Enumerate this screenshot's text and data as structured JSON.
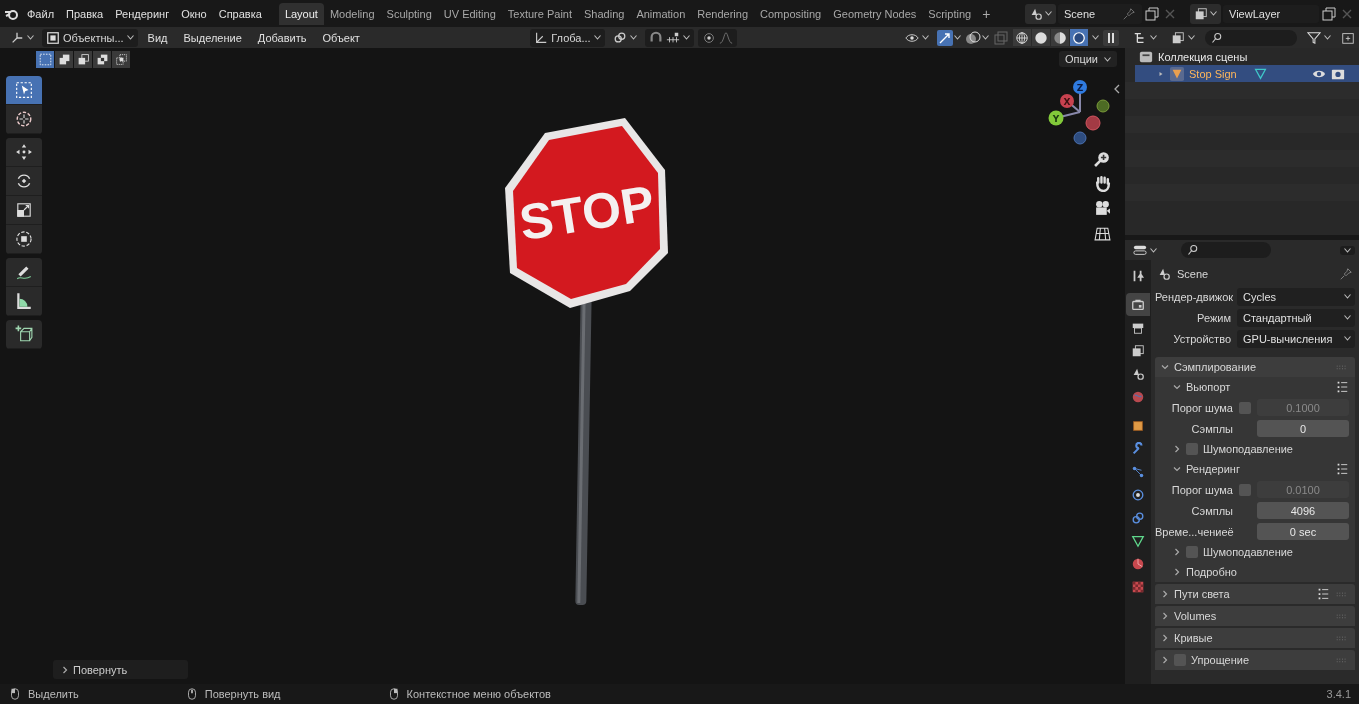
{
  "menu": [
    "Файл",
    "Правка",
    "Рендеринг",
    "Окно",
    "Справка"
  ],
  "workspaces": [
    {
      "label": "Layout",
      "selected": true
    },
    {
      "label": "Modeling",
      "selected": false
    },
    {
      "label": "Sculpting",
      "selected": false
    },
    {
      "label": "UV Editing",
      "selected": false
    },
    {
      "label": "Texture Paint",
      "selected": false
    },
    {
      "label": "Shading",
      "selected": false
    },
    {
      "label": "Animation",
      "selected": false
    },
    {
      "label": "Rendering",
      "selected": false
    },
    {
      "label": "Compositing",
      "selected": false
    },
    {
      "label": "Geometry Nodes",
      "selected": false
    },
    {
      "label": "Scripting",
      "selected": false
    }
  ],
  "add_workspace": "+",
  "scene": "Scene",
  "view_layer": "ViewLayer",
  "viewport": {
    "mode": "Объектны...",
    "menus": [
      "Вид",
      "Выделение",
      "Добавить",
      "Объект"
    ],
    "orientation": "Глоба...",
    "shading": [
      {
        "kind": "wireframe",
        "selected": false
      },
      {
        "kind": "solid",
        "selected": false
      },
      {
        "kind": "material",
        "selected": false
      },
      {
        "kind": "rendered",
        "selected": true
      }
    ],
    "select_modes": [
      {
        "kind": "set",
        "selected": true
      },
      {
        "kind": "extend",
        "selected": false
      },
      {
        "kind": "subtract",
        "selected": false
      },
      {
        "kind": "difference",
        "selected": false
      },
      {
        "kind": "intersect",
        "selected": false
      }
    ],
    "options": "Опции",
    "tools": [
      [
        {
          "kind": "select-box",
          "selected": true
        },
        {
          "kind": "cursor",
          "selected": false
        }
      ],
      [
        {
          "kind": "move",
          "selected": false
        },
        {
          "kind": "rotate",
          "selected": false
        },
        {
          "kind": "scale",
          "selected": false
        },
        {
          "kind": "transform",
          "selected": false
        }
      ],
      [
        {
          "kind": "annotate",
          "selected": false
        },
        {
          "kind": "measure",
          "selected": false
        }
      ],
      [
        {
          "kind": "add-cube",
          "selected": false
        }
      ]
    ],
    "axis_labels": [
      "X",
      "Y",
      "Z"
    ],
    "sign_text": "STOP",
    "last_operator": "Повернуть"
  },
  "outliner": {
    "collection": "Коллекция сцены",
    "objects": [
      {
        "name": "Stop Sign",
        "selected": true
      }
    ]
  },
  "properties": {
    "tabs": [
      {
        "kind": "tool",
        "selected": false
      },
      {
        "kind": "render",
        "selected": true
      },
      {
        "kind": "output",
        "selected": false
      },
      {
        "kind": "view-layer",
        "selected": false
      },
      {
        "kind": "scene",
        "selected": false
      },
      {
        "kind": "world",
        "selected": false
      },
      {
        "kind": "object",
        "selected": false
      },
      {
        "kind": "modifier",
        "selected": false
      },
      {
        "kind": "particles",
        "selected": false
      },
      {
        "kind": "physics",
        "selected": false
      },
      {
        "kind": "constraints",
        "selected": false
      },
      {
        "kind": "data",
        "selected": false
      },
      {
        "kind": "material",
        "selected": false
      },
      {
        "kind": "texture",
        "selected": false
      }
    ],
    "context": "Scene",
    "settings": [
      {
        "label": "Рендер-движок",
        "value": "Cycles"
      },
      {
        "label": "Режим",
        "value": "Стандартный"
      },
      {
        "label": "Устройство",
        "value": "GPU-вычисления"
      }
    ],
    "rows": [
      {
        "kind": "panel",
        "label": "Сэмплирование",
        "expanded": true
      },
      {
        "kind": "subpanel",
        "label": "Вьюпорт",
        "expanded": true,
        "presets": true
      },
      {
        "kind": "field",
        "label": "Порог шума",
        "checked": false,
        "value": "0.1000",
        "disabled": true
      },
      {
        "kind": "field",
        "label": "Сэмплы",
        "value": "0",
        "disabled": false
      },
      {
        "kind": "subpanel",
        "label": "Шумоподавление",
        "expanded": false,
        "checked": false
      },
      {
        "kind": "subpanel",
        "label": "Рендеринг",
        "expanded": true,
        "presets": true
      },
      {
        "kind": "field",
        "label": "Порог шума",
        "checked": false,
        "value": "0.0100",
        "disabled": true
      },
      {
        "kind": "field",
        "label": "Сэмплы",
        "value": "4096",
        "disabled": false
      },
      {
        "kind": "field",
        "label": "Време...чениеё",
        "value": "0 sec",
        "disabled": false
      },
      {
        "kind": "subpanel",
        "label": "Шумоподавление",
        "expanded": false,
        "checked": false
      },
      {
        "kind": "subpanel",
        "label": "Подробно",
        "expanded": false
      },
      {
        "kind": "panel",
        "label": "Пути света",
        "expanded": false,
        "presets": true
      },
      {
        "kind": "panel",
        "label": "Volumes",
        "expanded": false
      },
      {
        "kind": "panel",
        "label": "Кривые",
        "expanded": false
      },
      {
        "kind": "panel",
        "label": "Упрощение",
        "expanded": false,
        "checked": false
      }
    ]
  },
  "status_bar": {
    "hints": [
      {
        "kind": "left",
        "label": "Выделить"
      },
      {
        "kind": "middle",
        "label": "Повернуть вид"
      },
      {
        "kind": "right",
        "label": "Контекстное меню объектов"
      }
    ],
    "version": "3.4.1"
  }
}
